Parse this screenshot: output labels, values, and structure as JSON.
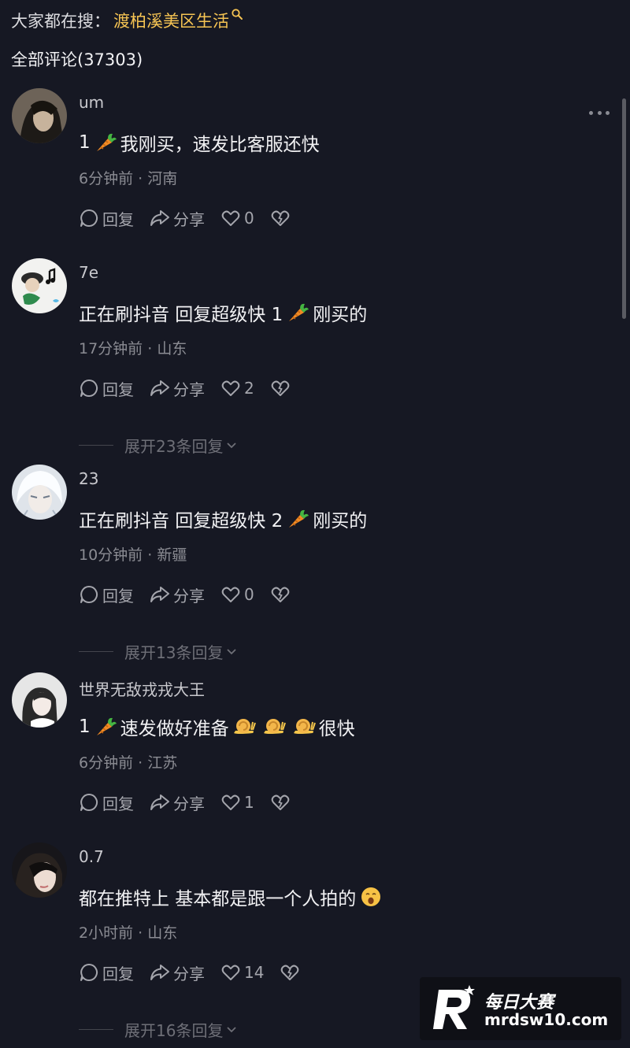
{
  "search_hint": {
    "prefix": "大家都在搜：",
    "term": "渡柏溪美区生活",
    "accent_color": "#f6c453",
    "icon": "search-icon"
  },
  "comments_header": {
    "title": "全部评论(37303)"
  },
  "labels": {
    "reply": "回复",
    "share": "分享"
  },
  "comments": [
    {
      "username": "um",
      "body": [
        {
          "t": "1 "
        },
        {
          "e": "carrot"
        },
        {
          "t": " 我刚买，速发比客服还快"
        }
      ],
      "time": "6分钟前",
      "location": "河南",
      "likes": "0",
      "expand": ""
    },
    {
      "username": "7e",
      "body": [
        {
          "t": "正在刷抖音 回复超级快 1 "
        },
        {
          "e": "carrot"
        },
        {
          "t": " 刚买的"
        }
      ],
      "time": "17分钟前",
      "location": "山东",
      "likes": "2",
      "expand": "展开23条回复"
    },
    {
      "username": "23",
      "body": [
        {
          "t": "正在刷抖音 回复超级快 2 "
        },
        {
          "e": "carrot"
        },
        {
          "t": " 刚买的"
        }
      ],
      "time": "10分钟前",
      "location": "新疆",
      "likes": "0",
      "expand": "展开13条回复"
    },
    {
      "username": "世界无敌戎戎大王",
      "body": [
        {
          "t": "1 "
        },
        {
          "e": "carrot"
        },
        {
          "t": " 速发做好准备 "
        },
        {
          "e": "snail"
        },
        {
          "e": "snail"
        },
        {
          "e": "snail"
        },
        {
          "t": " 很快"
        }
      ],
      "time": "6分钟前",
      "location": "江苏",
      "likes": "1",
      "expand": ""
    },
    {
      "username": "0.7",
      "body": [
        {
          "t": "都在推特上 基本都是跟一个人拍的 "
        },
        {
          "e": "yawn-face"
        }
      ],
      "time": "2小时前",
      "location": "山东",
      "likes": "14",
      "expand": "展开16条回复"
    }
  ],
  "watermark": {
    "brand": "每日大赛",
    "domain": "mrdsw10.com"
  }
}
